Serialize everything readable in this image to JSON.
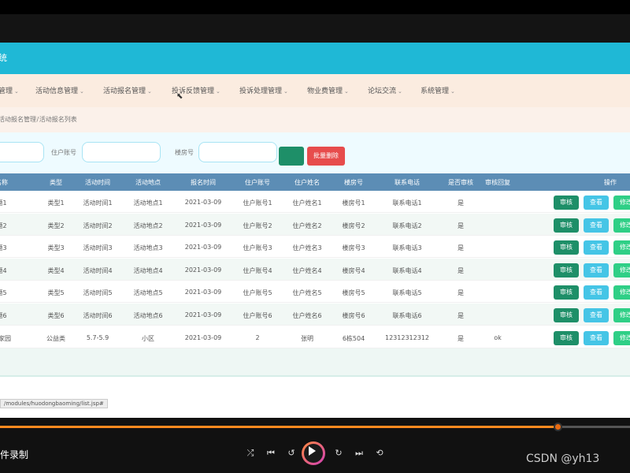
{
  "app": {
    "title_partial": "统"
  },
  "nav": {
    "items": [
      {
        "label": "管理"
      },
      {
        "label": "活动信息管理"
      },
      {
        "label": "活动报名管理"
      },
      {
        "label": "投诉反馈管理"
      },
      {
        "label": "投诉处理管理"
      },
      {
        "label": "物业费管理"
      },
      {
        "label": "论坛交流"
      },
      {
        "label": "系统管理"
      }
    ]
  },
  "breadcrumb": {
    "parent": "活动报名管理",
    "separator": "/",
    "current": "活动报名列表"
  },
  "search": {
    "label_account": "住户账号",
    "label_building": "楼房号",
    "batch_delete_label": "批量删除"
  },
  "table": {
    "headers": [
      "名称",
      "类型",
      "活动时间",
      "活动地点",
      "报名时间",
      "住户账号",
      "住户姓名",
      "楼房号",
      "联系电话",
      "是否审核",
      "审核回复",
      "操作"
    ],
    "rows": [
      [
        "题1",
        "类型1",
        "活动时间1",
        "活动地点1",
        "2021-03-09",
        "住户账号1",
        "住户姓名1",
        "楼房号1",
        "联系电话1",
        "是",
        ""
      ],
      [
        "题2",
        "类型2",
        "活动时间2",
        "活动地点2",
        "2021-03-09",
        "住户账号2",
        "住户姓名2",
        "楼房号2",
        "联系电话2",
        "是",
        ""
      ],
      [
        "题3",
        "类型3",
        "活动时间3",
        "活动地点3",
        "2021-03-09",
        "住户账号3",
        "住户姓名3",
        "楼房号3",
        "联系电话3",
        "是",
        ""
      ],
      [
        "题4",
        "类型4",
        "活动时间4",
        "活动地点4",
        "2021-03-09",
        "住户账号4",
        "住户姓名4",
        "楼房号4",
        "联系电话4",
        "是",
        ""
      ],
      [
        "题5",
        "类型5",
        "活动时间5",
        "活动地点5",
        "2021-03-09",
        "住户账号5",
        "住户姓名5",
        "楼房号5",
        "联系电话5",
        "是",
        ""
      ],
      [
        "题6",
        "类型6",
        "活动时间6",
        "活动地点6",
        "2021-03-09",
        "住户账号6",
        "住户姓名6",
        "楼房号6",
        "联系电话6",
        "是",
        ""
      ],
      [
        "康家园",
        "公益类",
        "5.7-5.9",
        "小区",
        "2021-03-09",
        "2",
        "张明",
        "6栋504",
        "12312312312",
        "是",
        "ok"
      ]
    ],
    "actions": {
      "review": "审核",
      "view": "查看",
      "edit": "修改"
    }
  },
  "status_url": "/modules/huodongbaoming/list.jsp#",
  "player": {
    "recording_label": "件录制",
    "progress_fraction": 0.885,
    "watermark": "CSDN @yh13"
  },
  "colors": {
    "titlebar": "#1fb8d6",
    "table_header": "#5c8db5",
    "review_btn": "#1e8f68",
    "view_btn": "#45c5e6",
    "edit_btn": "#2fcf86",
    "delete_btn": "#e74c4c",
    "progress": "#ff8a1f"
  }
}
